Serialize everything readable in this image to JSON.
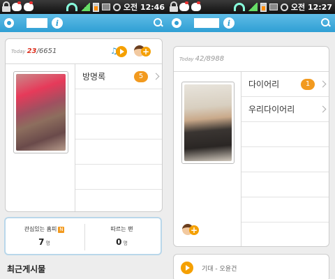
{
  "colors": {
    "appbar": "#2f9fd4",
    "badge_orange": "#f29a1f",
    "today_count_red": "#d32f2f"
  },
  "left": {
    "status": {
      "time": "오전 12:46"
    },
    "card": {
      "today_label": "Today",
      "today_count": "23",
      "total_count": "/6651",
      "menu": [
        {
          "label": "방명록",
          "badge": "5"
        },
        {
          "label": "",
          "badge": ""
        },
        {
          "label": "",
          "badge": ""
        },
        {
          "label": "",
          "badge": ""
        },
        {
          "label": "",
          "badge": ""
        },
        {
          "label": "",
          "badge": ""
        }
      ]
    },
    "stats": {
      "interest_label": "관심있는 홈피",
      "interest_badge": "N",
      "interest_value": "7",
      "interest_unit": "명",
      "follower_label": "따르는 팬",
      "follower_value": "0",
      "follower_unit": "명"
    },
    "recent_posts_label": "최근게시물"
  },
  "right": {
    "status": {
      "time": "오전 12:27"
    },
    "card": {
      "today_label": "Today",
      "today_count": "42",
      "total_count": "/8988",
      "menu": [
        {
          "label": "다이어리",
          "badge": "1"
        },
        {
          "label": "우리다이어리",
          "badge": ""
        },
        {
          "label": "",
          "badge": ""
        },
        {
          "label": "",
          "badge": ""
        },
        {
          "label": "",
          "badge": ""
        },
        {
          "label": "",
          "badge": ""
        }
      ]
    },
    "bottom_text": "기대 - 오윤건"
  }
}
